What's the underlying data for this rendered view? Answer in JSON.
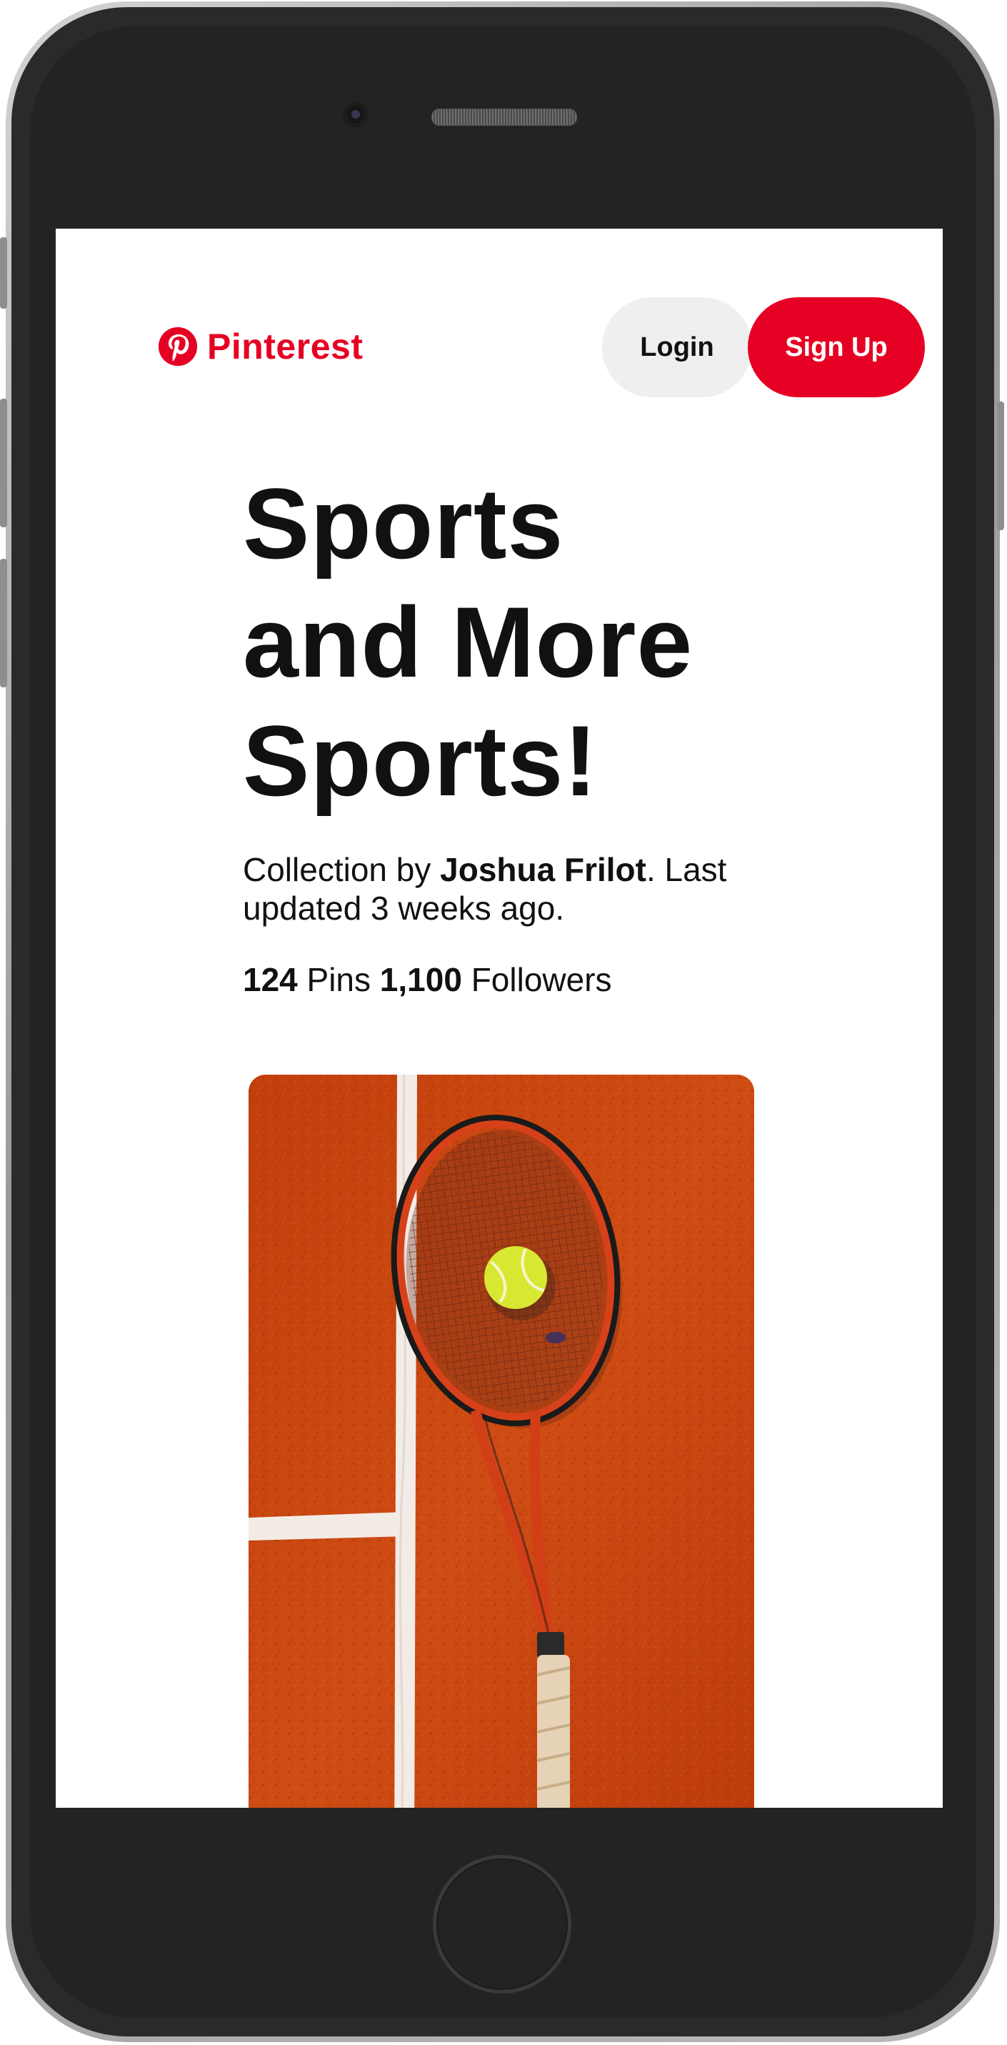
{
  "header": {
    "brand": "Pinterest",
    "login_label": "Login",
    "signup_label": "Sign Up"
  },
  "board": {
    "title_lines": [
      "Sports",
      "and More",
      "Sports!"
    ],
    "collection_prefix": "Collection by ",
    "author": "Joshua Frilot",
    "collection_suffix": ". Last updated 3 weeks ago.",
    "pins_count": "124",
    "pins_label": " Pins ",
    "followers_count": "1,100",
    "followers_label": " Followers"
  },
  "colors": {
    "brand_red": "#e60023",
    "login_bg": "#efefef",
    "clay": "#c8450f"
  },
  "icons": {
    "logo": "pinterest-logo-icon"
  }
}
